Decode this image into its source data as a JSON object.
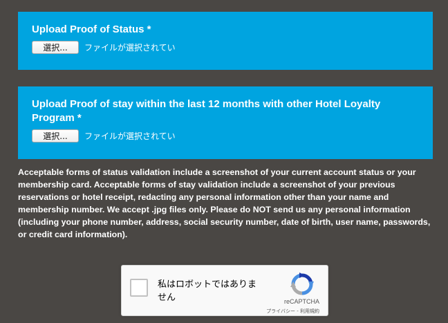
{
  "status_upload": {
    "label": "Upload Proof of Status *",
    "button_label": "選択...",
    "file_status": "ファイルが選択されてい"
  },
  "stay_upload": {
    "label": "Upload Proof of stay within the last 12 months with other Hotel Loyalty Program *",
    "button_label": "選択...",
    "file_status": "ファイルが選択されてい"
  },
  "notice": "Acceptable forms of status validation include a screenshot of your current account status or your membership card. Acceptable forms of stay validation include a screenshot of your previous reservations or hotel receipt, redacting any personal information other than your name and membership number. We accept .jpg files only. Please do NOT send us any personal information (including your phone number, address, social security number, date of birth, user name, passwords, or credit card information).",
  "captcha": {
    "label": "私はロボットではありません",
    "brand": "reCAPTCHA",
    "privacy": "プライバシー",
    "separator": " - ",
    "terms": "利用規約",
    "icon": "recaptcha-logo"
  },
  "colors": {
    "background": "#4a4744",
    "panel": "#00a4e0",
    "text": "#ffffff"
  }
}
